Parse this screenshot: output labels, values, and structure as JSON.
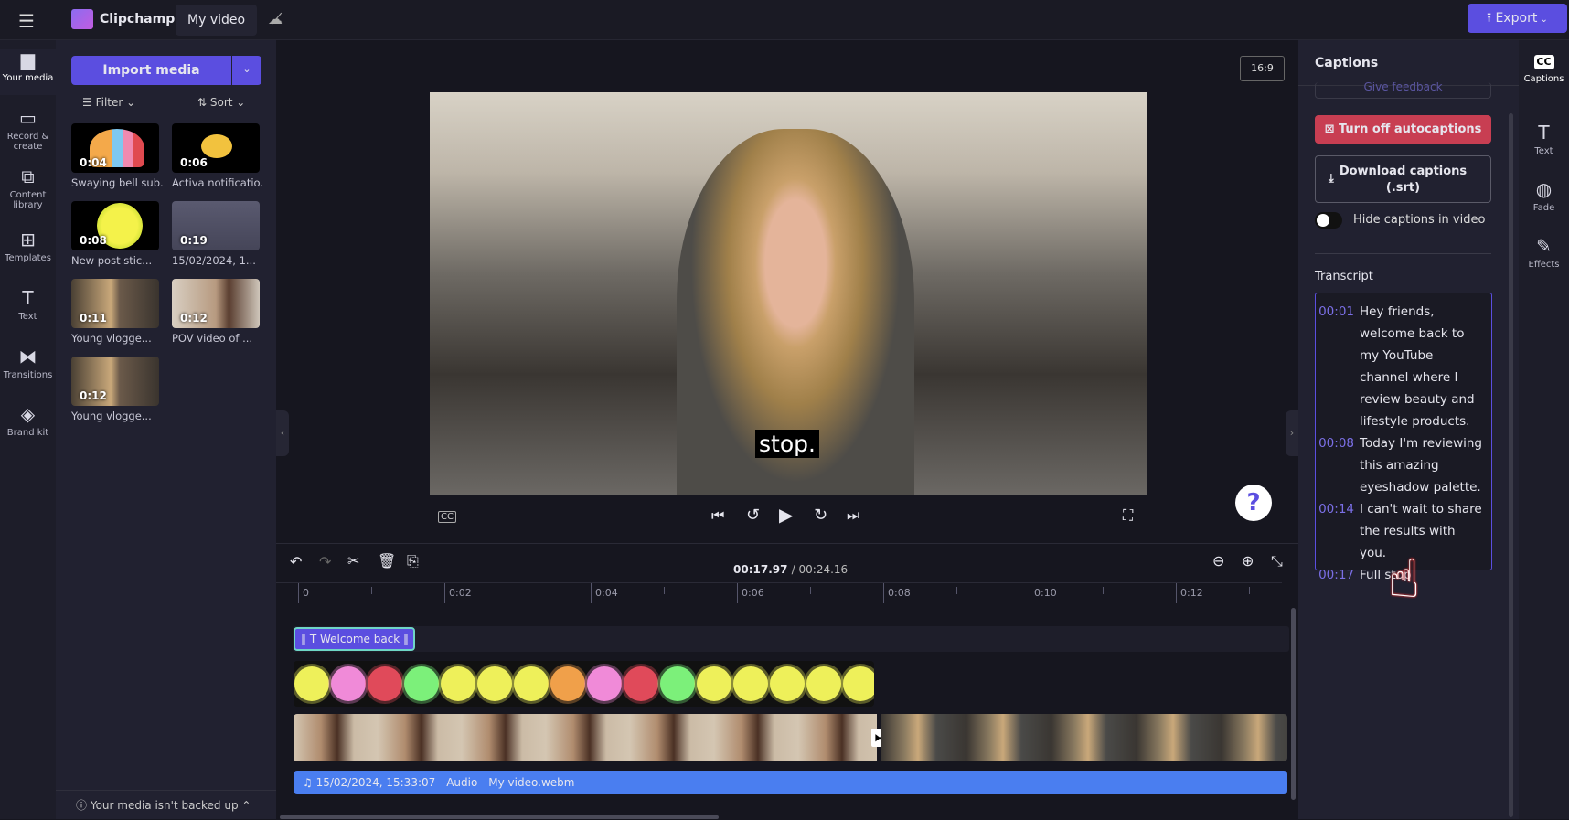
{
  "app": {
    "name": "Clipchamp",
    "project_title": "My video",
    "export_label": "Export"
  },
  "rail": [
    {
      "icon": "folder-icon",
      "label": "Your media"
    },
    {
      "icon": "camera-icon",
      "label": "Record & create"
    },
    {
      "icon": "library-icon",
      "label": "Content library"
    },
    {
      "icon": "templates-icon",
      "label": "Templates"
    },
    {
      "icon": "text-icon",
      "label": "Text"
    },
    {
      "icon": "transitions-icon",
      "label": "Transitions"
    },
    {
      "icon": "brand-kit-icon",
      "label": "Brand kit"
    }
  ],
  "media": {
    "import_label": "Import media",
    "filter_label": "Filter",
    "sort_label": "Sort",
    "items": [
      {
        "duration": "0:04",
        "label": "Swaying bell sub..."
      },
      {
        "duration": "0:06",
        "label": "Activa notificatio..."
      },
      {
        "duration": "0:08",
        "label": "New post stic..."
      },
      {
        "duration": "0:19",
        "label": "15/02/2024, 1..."
      },
      {
        "duration": "0:11",
        "label": "Young vlogge..."
      },
      {
        "duration": "0:12",
        "label": "POV video of ..."
      },
      {
        "duration": "0:12",
        "label": "Young vlogge..."
      }
    ],
    "backup_notice": "Your media isn't backed up"
  },
  "preview": {
    "aspect_ratio": "16:9",
    "caption": "stop.",
    "help": "?"
  },
  "timeline": {
    "current_time": "00:17.97",
    "total_time": "/ 00:24.16",
    "ruler": [
      "0",
      "0:02",
      "0:04",
      "0:06",
      "0:08",
      "0:10",
      "0:12"
    ],
    "text_clip": "Welcome back",
    "audio_clip": "15/02/2024, 15:33:07 - Audio - My video.webm"
  },
  "captions": {
    "title": "Captions",
    "give_feedback": "Give feedback",
    "turn_off": "Turn off autocaptions",
    "download_line1": "Download captions",
    "download_line2": "(.srt)",
    "hide_toggle_label": "Hide captions in video",
    "hide_toggle_on": false,
    "transcript_title": "Transcript",
    "transcript": [
      {
        "time": "00:01",
        "text": "Hey friends, welcome back to my YouTube channel where I review beauty and lifestyle products."
      },
      {
        "time": "00:08",
        "text": "Today I'm reviewing this amazing eyeshadow palette."
      },
      {
        "time": "00:14",
        "text": "I can't wait to share the results with you."
      },
      {
        "time": "00:17",
        "text": "Full stop"
      }
    ]
  },
  "right_rail": [
    {
      "icon": "cc-icon",
      "label": "Captions"
    },
    {
      "icon": "text-icon",
      "label": "Text"
    },
    {
      "icon": "fade-icon",
      "label": "Fade"
    },
    {
      "icon": "effects-icon",
      "label": "Effects"
    }
  ],
  "colors": {
    "accent": "#5b4ee0",
    "danger": "#c83e52",
    "audio": "#4a7ef0"
  }
}
